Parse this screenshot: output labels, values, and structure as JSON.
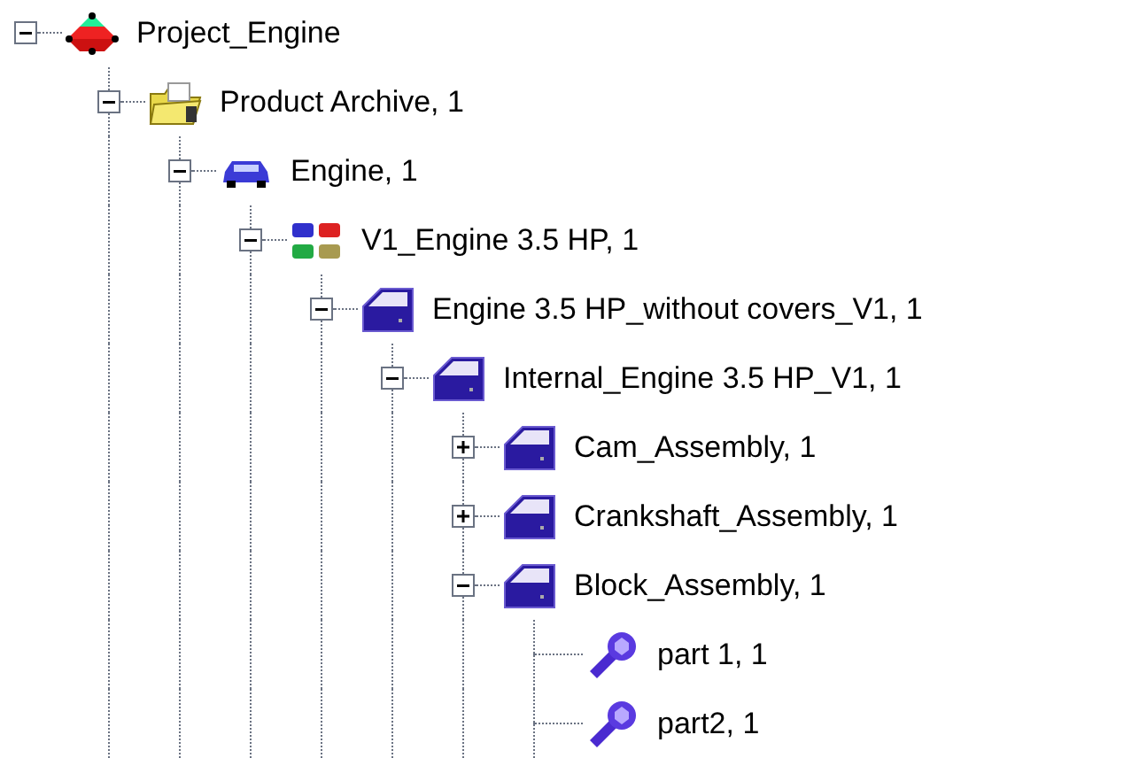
{
  "tree": [
    {
      "label": "Project_Engine",
      "kind": "project",
      "expanded": true,
      "children": [
        {
          "label": "Product Archive, 1",
          "kind": "folder",
          "expanded": true,
          "children": [
            {
              "label": "Engine, 1",
              "kind": "car",
              "expanded": true,
              "children": [
                {
                  "label": "V1_Engine 3.5 HP, 1",
                  "kind": "cars",
                  "expanded": true,
                  "children": [
                    {
                      "label": "Engine 3.5 HP_without covers_V1, 1",
                      "kind": "assembly",
                      "expanded": true,
                      "children": [
                        {
                          "label": "Internal_Engine 3.5 HP_V1, 1",
                          "kind": "assembly",
                          "expanded": true,
                          "children": [
                            {
                              "label": "Cam_Assembly, 1",
                              "kind": "assembly",
                              "expanded": false
                            },
                            {
                              "label": "Crankshaft_Assembly, 1",
                              "kind": "assembly",
                              "expanded": false
                            },
                            {
                              "label": "Block_Assembly, 1",
                              "kind": "assembly",
                              "expanded": true,
                              "children": [
                                {
                                  "label": "part 1, 1",
                                  "kind": "part"
                                },
                                {
                                  "label": "part2, 1",
                                  "kind": "part"
                                }
                              ]
                            }
                          ]
                        }
                      ]
                    }
                  ]
                }
              ]
            }
          ]
        }
      ]
    }
  ]
}
